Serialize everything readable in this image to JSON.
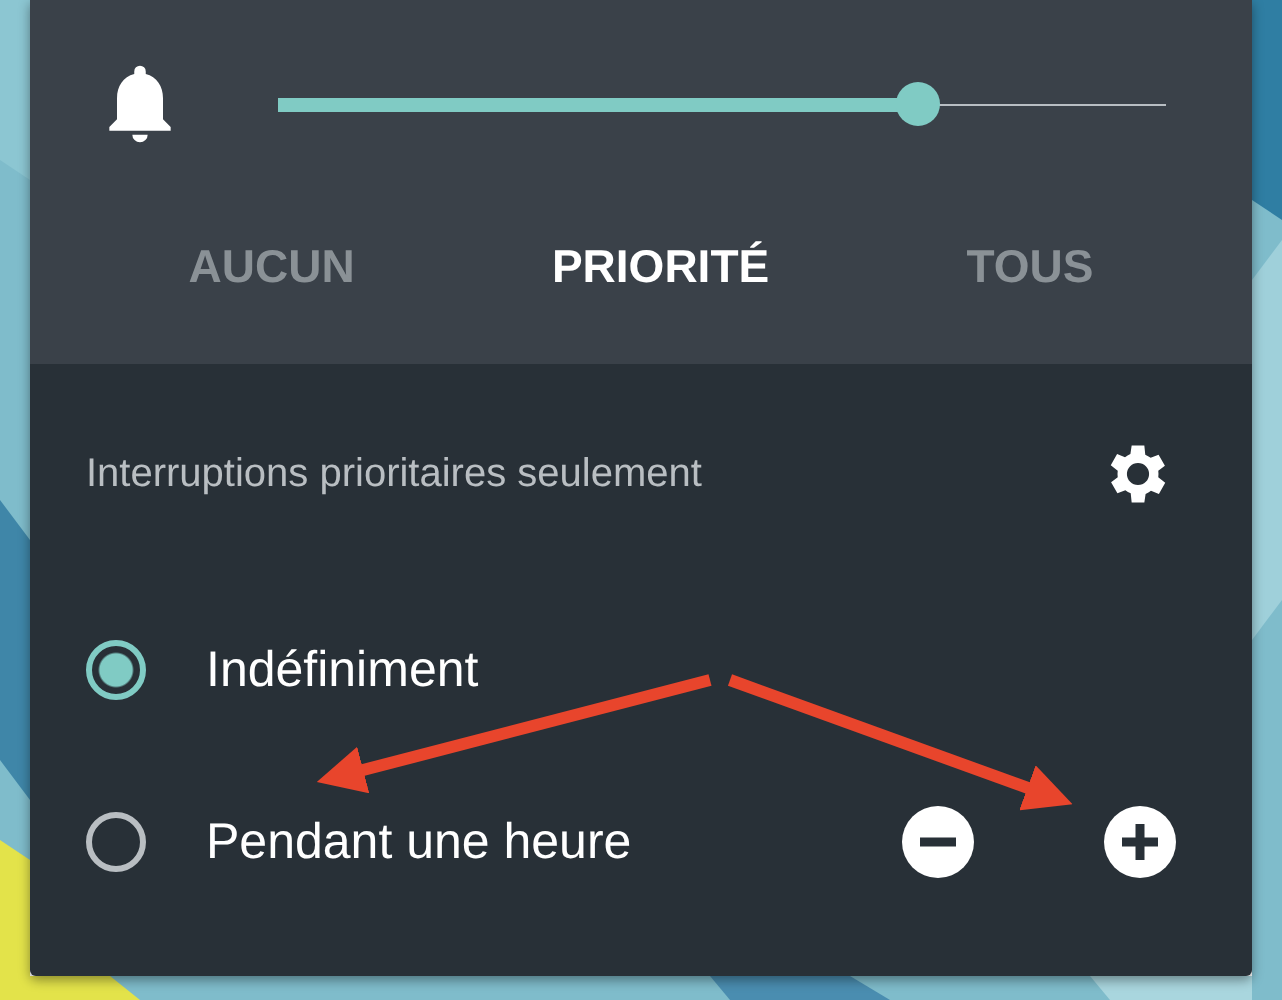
{
  "volume": {
    "level": 0.72
  },
  "tabs": [
    {
      "label": "AUCUN",
      "selected": false
    },
    {
      "label": "PRIORITÉ",
      "selected": true
    },
    {
      "label": "TOUS",
      "selected": false
    }
  ],
  "section_title": "Interruptions prioritaires seulement",
  "options": [
    {
      "label": "Indéfiniment",
      "selected": true,
      "stepper": false
    },
    {
      "label": "Pendant une heure",
      "selected": false,
      "stepper": true
    }
  ]
}
